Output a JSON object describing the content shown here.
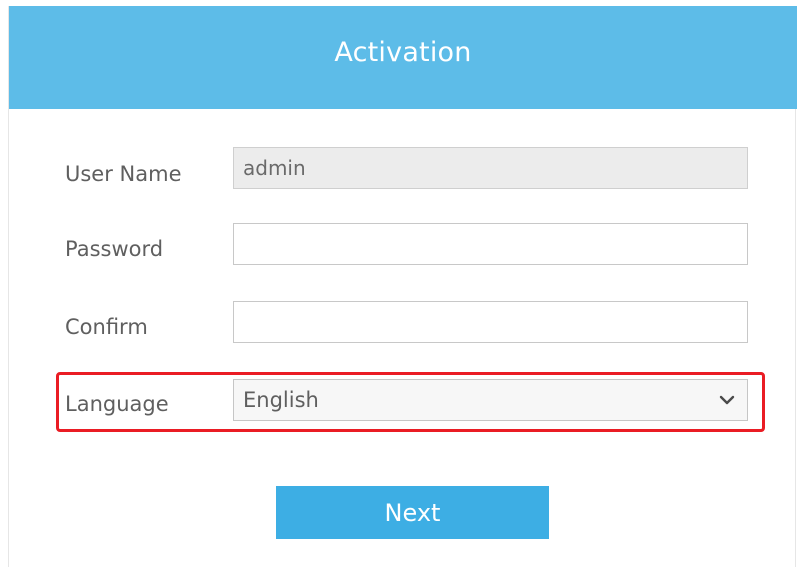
{
  "dialog": {
    "title": "Activation"
  },
  "form": {
    "username": {
      "label": "User Name",
      "value": "admin"
    },
    "password": {
      "label": "Password",
      "value": ""
    },
    "confirm": {
      "label": "Confirm",
      "value": ""
    },
    "language": {
      "label": "Language",
      "selected": "English"
    }
  },
  "actions": {
    "next_label": "Next"
  },
  "colors": {
    "header": "#5dbce8",
    "button": "#3daee4",
    "highlight": "#ea1c24"
  },
  "icons": {
    "language_dropdown": "chevron-down-icon"
  }
}
